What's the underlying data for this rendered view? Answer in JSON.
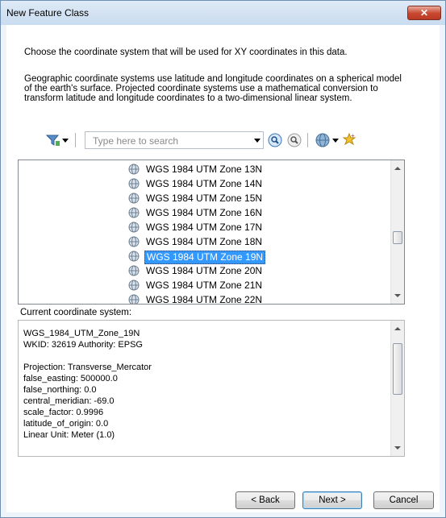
{
  "window": {
    "title": "New Feature Class"
  },
  "intro": {
    "line1": "Choose the coordinate system that will be used for XY coordinates in this data.",
    "line2a": "Geographic coordinate systems use latitude and longitude coordinates on a spherical model",
    "line2b": "of the earth's surface. Projected coordinate systems use a mathematical conversion to",
    "line2c": "transform latitude and longitude coordinates to a two-dimensional linear system."
  },
  "toolbar": {
    "search_placeholder": "Type here to search",
    "icons": [
      "filter-icon",
      "dropdown-arrow-icon",
      "search-icon",
      "clear-search-icon",
      "globe-icon",
      "add-favorite-icon"
    ]
  },
  "list": {
    "items": [
      "WGS 1984 UTM Zone 13N",
      "WGS 1984 UTM Zone 14N",
      "WGS 1984 UTM Zone 15N",
      "WGS 1984 UTM Zone 16N",
      "WGS 1984 UTM Zone 17N",
      "WGS 1984 UTM Zone 18N",
      "WGS 1984 UTM Zone 19N",
      "WGS 1984 UTM Zone 20N",
      "WGS 1984 UTM Zone 21N",
      "WGS 1984 UTM Zone 22N"
    ],
    "selected": "WGS 1984 UTM Zone 19N"
  },
  "current": {
    "label": "Current coordinate system:",
    "lines": [
      "WGS_1984_UTM_Zone_19N",
      "WKID: 32619 Authority: EPSG",
      "",
      "Projection: Transverse_Mercator",
      "false_easting: 500000.0",
      "false_northing: 0.0",
      "central_meridian: -69.0",
      "scale_factor: 0.9996",
      "latitude_of_origin: 0.0",
      "Linear Unit: Meter (1.0)"
    ]
  },
  "buttons": {
    "back": "< Back",
    "next": "Next >",
    "cancel": "Cancel"
  },
  "colors": {
    "selection": "#3399ff",
    "close_button": "#c8462f"
  }
}
